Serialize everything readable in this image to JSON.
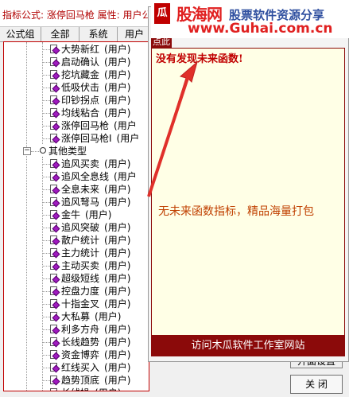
{
  "header": {
    "title": "指标公式: 涨停回马枪  属性: 用户公"
  },
  "tabs": [
    "公式组",
    "全部",
    "系统",
    "用户"
  ],
  "tree": {
    "items_group_a": [
      {
        "name": "大势新红",
        "tag": "(用户)"
      },
      {
        "name": "启动确认",
        "tag": "(用户)"
      },
      {
        "name": "挖坑藏金",
        "tag": "(用户)"
      },
      {
        "name": "低吸伏击",
        "tag": "(用户)"
      },
      {
        "name": "印钞拐点",
        "tag": "(用户)"
      },
      {
        "name": "均线粘合",
        "tag": "(用户)"
      },
      {
        "name": "涨停回马枪",
        "tag": "(用户"
      },
      {
        "name": "涨停回马枪I",
        "tag": "(用户"
      }
    ],
    "folder": {
      "name": "其他类型",
      "expander": "−"
    },
    "items_group_b": [
      {
        "name": "追风买卖",
        "tag": "(用户)"
      },
      {
        "name": "追风全息线",
        "tag": "(用户"
      },
      {
        "name": "全息未来",
        "tag": "(用户)"
      },
      {
        "name": "追风弩马",
        "tag": "(用户)"
      },
      {
        "name": "金牛",
        "tag": "(用户)"
      },
      {
        "name": "追风突破",
        "tag": "(用户)"
      },
      {
        "name": "散户统计",
        "tag": "(用户)"
      },
      {
        "name": "主力统计",
        "tag": "(用户)"
      },
      {
        "name": "主动买卖",
        "tag": "(用户)"
      },
      {
        "name": "超级短线",
        "tag": "(用户)"
      },
      {
        "name": "控盘力度",
        "tag": "(用户)"
      },
      {
        "name": "十指金叉",
        "tag": "(用户)"
      },
      {
        "name": "大私募",
        "tag": "(用户)"
      },
      {
        "name": "利多方舟",
        "tag": "(用户)"
      },
      {
        "name": "长线趋势",
        "tag": "(用户)"
      },
      {
        "name": "资金博弈",
        "tag": "(用户)"
      },
      {
        "name": "红线买入",
        "tag": "(用户)"
      },
      {
        "name": "趋势顶底",
        "tag": "(用户)"
      },
      {
        "name": "长线操",
        "tag": "(用户)"
      }
    ]
  },
  "buttons": {
    "open_label": "开面设置",
    "close_label": "关 闭"
  },
  "popup": {
    "tab_label": "点此",
    "no_future": "没有发现未来函数!",
    "ad_text": "无未来函数指标，精品海量打包",
    "footer_link": "访问木瓜软件工作室网站"
  },
  "watermark": {
    "logo_char": "瓜",
    "name": "股海网",
    "slogan": "股票软件资源分享",
    "url": "www.Guhai.com.cn"
  },
  "colors": {
    "title_red": "#b00000",
    "popup_dark_red": "#8b0a0a",
    "popup_bg": "#ffffe6",
    "arrow_red": "#e0302a",
    "icon_purple": "#a01bc0"
  }
}
